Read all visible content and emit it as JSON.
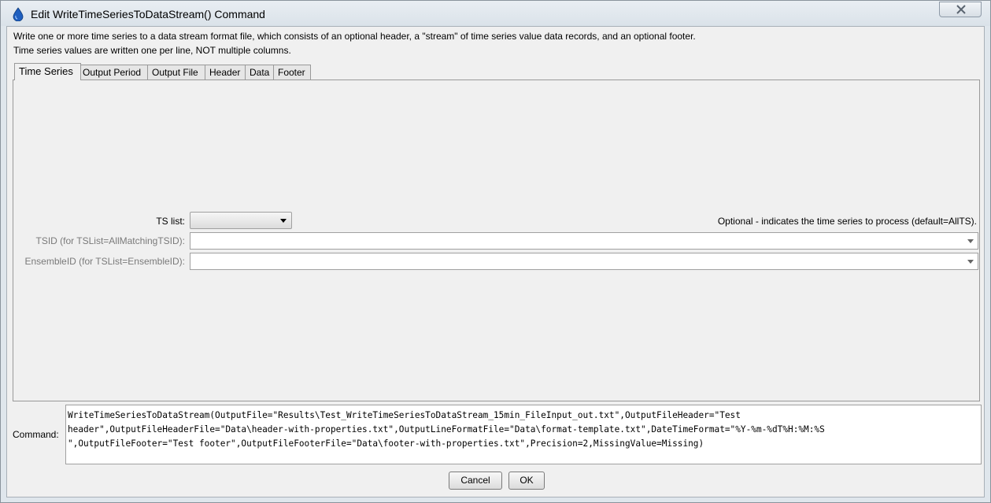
{
  "window": {
    "title": "Edit WriteTimeSeriesToDataStream() Command"
  },
  "description": {
    "line1": "Write one or more time series to a data stream format file, which consists of an optional header, a \"stream\" of time series value data records, and an optional footer.",
    "line2": "Time series values are written one per line, NOT multiple columns."
  },
  "tabs": [
    {
      "label": "Time Series",
      "active": true
    },
    {
      "label": "Output Period",
      "active": false
    },
    {
      "label": "Output File",
      "active": false
    },
    {
      "label": "Header",
      "active": false
    },
    {
      "label": "Data",
      "active": false
    },
    {
      "label": "Footer",
      "active": false
    }
  ],
  "time_series_tab": {
    "ts_list_label": "TS list:",
    "ts_list_value": "",
    "ts_list_note": "Optional - indicates the time series to process (default=AllTS).",
    "tsid_label": "TSID (for TSList=AllMatchingTSID):",
    "tsid_value": "",
    "ensemble_label": "EnsembleID (for TSList=EnsembleID):",
    "ensemble_value": ""
  },
  "command": {
    "label": "Command:",
    "line1": "WriteTimeSeriesToDataStream(OutputFile=\"Results\\Test_WriteTimeSeriesToDataStream_15min_FileInput_out.txt\",OutputFileHeader=\"Test",
    "line2": "header\",OutputFileHeaderFile=\"Data\\header-with-properties.txt\",OutputLineFormatFile=\"Data\\format-template.txt\",DateTimeFormat=\"%Y-%m-%dT%H:%M:%S",
    "line3": "\",OutputFileFooter=\"Test footer\",OutputFileFooterFile=\"Data\\footer-with-properties.txt\",Precision=2,MissingValue=Missing)"
  },
  "buttons": {
    "cancel": "Cancel",
    "ok": "OK"
  },
  "icons": {
    "title": "water-drop-icon",
    "close": "close-icon"
  },
  "colors": {
    "drop": "#1f5fbf"
  }
}
